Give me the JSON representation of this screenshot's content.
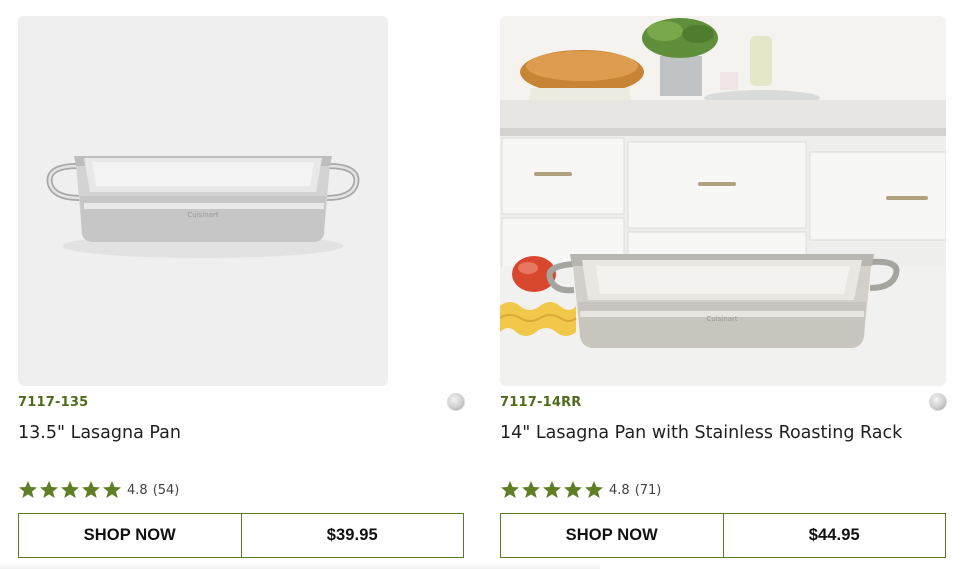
{
  "accent_color": "#4f6b1b",
  "button_border_color": "#5a7a22",
  "star_color": "#5f7f27",
  "products": [
    {
      "sku": "7117-135",
      "title": "13.5\" Lasagna Pan",
      "rating": "4.8",
      "reviews": "(54)",
      "shop_label": "SHOP NOW",
      "price": "$39.95",
      "image_icon": "stainless-lasagna-pan-product-photo",
      "brand_mark": "Cuisinart",
      "stars": 5
    },
    {
      "sku": "7117-14RR",
      "title": "14\" Lasagna Pan with Stainless Roasting Rack",
      "rating": "4.8",
      "reviews": "(71)",
      "shop_label": "SHOP NOW",
      "price": "$44.95",
      "image_icon": "lasagna-pan-kitchen-lifestyle-photo",
      "brand_mark": "Cuisinart",
      "stars": 5
    }
  ]
}
